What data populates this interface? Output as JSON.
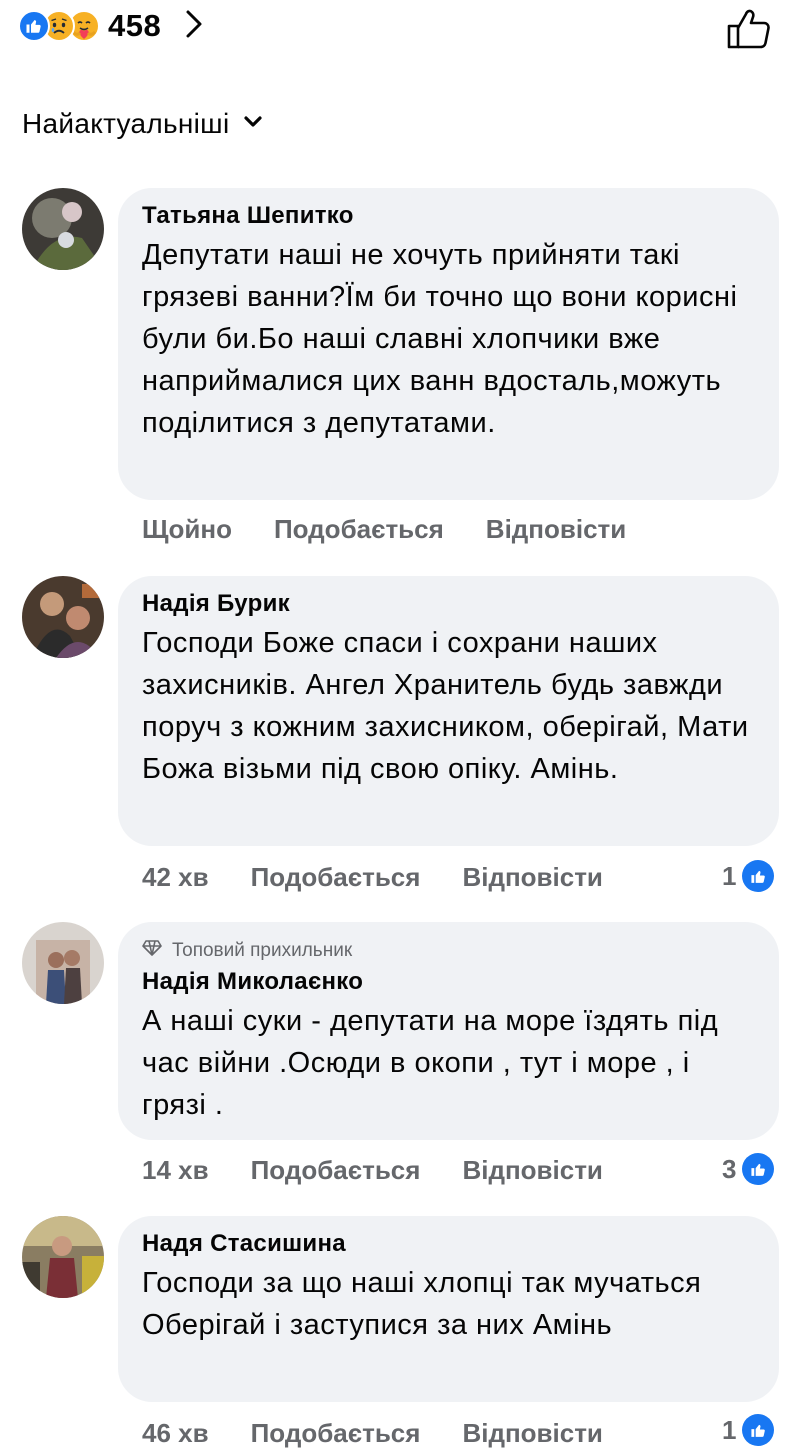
{
  "header": {
    "reaction_icons": [
      "like-reaction-icon",
      "sad-reaction-icon",
      "care-reaction-icon"
    ],
    "reaction_count": "458",
    "sort_label": "Найактуальніші"
  },
  "colors": {
    "accent": "#1877f2",
    "bubble": "#f0f2f5",
    "secondary_text": "#65676b"
  },
  "comments": [
    {
      "author": "Татьяна Шепитко",
      "text": "Депутати наші не хочуть прийняти такі грязеві ванни?Їм би точно що вони корисні були би.Бо наші славні хлопчики вже наприймалися цих ванн вдосталь,можуть поділитися з депутатами.",
      "time": "Щойно",
      "like_label": "Подобається",
      "reply_label": "Відповісти"
    },
    {
      "author": "Надія Бурик",
      "text": "Господи Боже спаси і сохрани наших захисників. Ангел Хранитель будь завжди поруч з кожним захисником, оберігай, Мати Божа візьми під свою опіку. Амінь.",
      "time": "42 хв",
      "like_label": "Подобається",
      "reply_label": "Відповісти",
      "likes": "1"
    },
    {
      "badge": "Топовий прихильник",
      "author": "Надія Миколаєнко",
      "text": "А наші суки - депутати на море їздять під час війни .Осюди в окопи  , тут і море , і грязі .",
      "time": "14 хв",
      "like_label": "Подобається",
      "reply_label": "Відповісти",
      "likes": "3"
    },
    {
      "author": "Надя Стасишина",
      "text": "Господи за що наші хлопці так мучаться Оберігай і заступися за них Амінь",
      "time": "46 хв",
      "like_label": "Подобається",
      "reply_label": "Відповісти",
      "likes": "1"
    }
  ]
}
